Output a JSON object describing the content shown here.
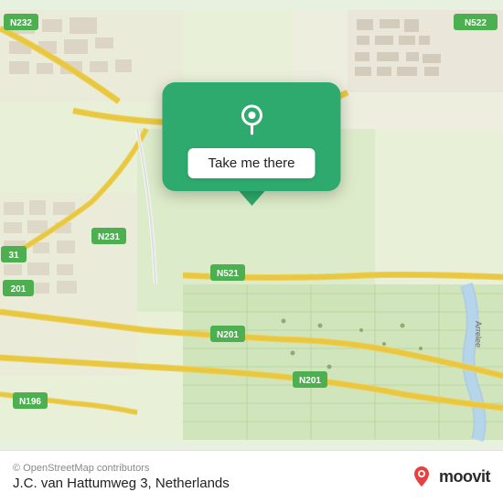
{
  "map": {
    "background_color": "#e8f0e0",
    "popup": {
      "button_label": "Take me there",
      "pin_color": "#fff",
      "bg_color": "#2eaa6e"
    }
  },
  "bottom_bar": {
    "address": "J.C. van Hattumweg 3, Netherlands",
    "attribution": "© OpenStreetMap contributors",
    "logo_text": "moovit"
  }
}
